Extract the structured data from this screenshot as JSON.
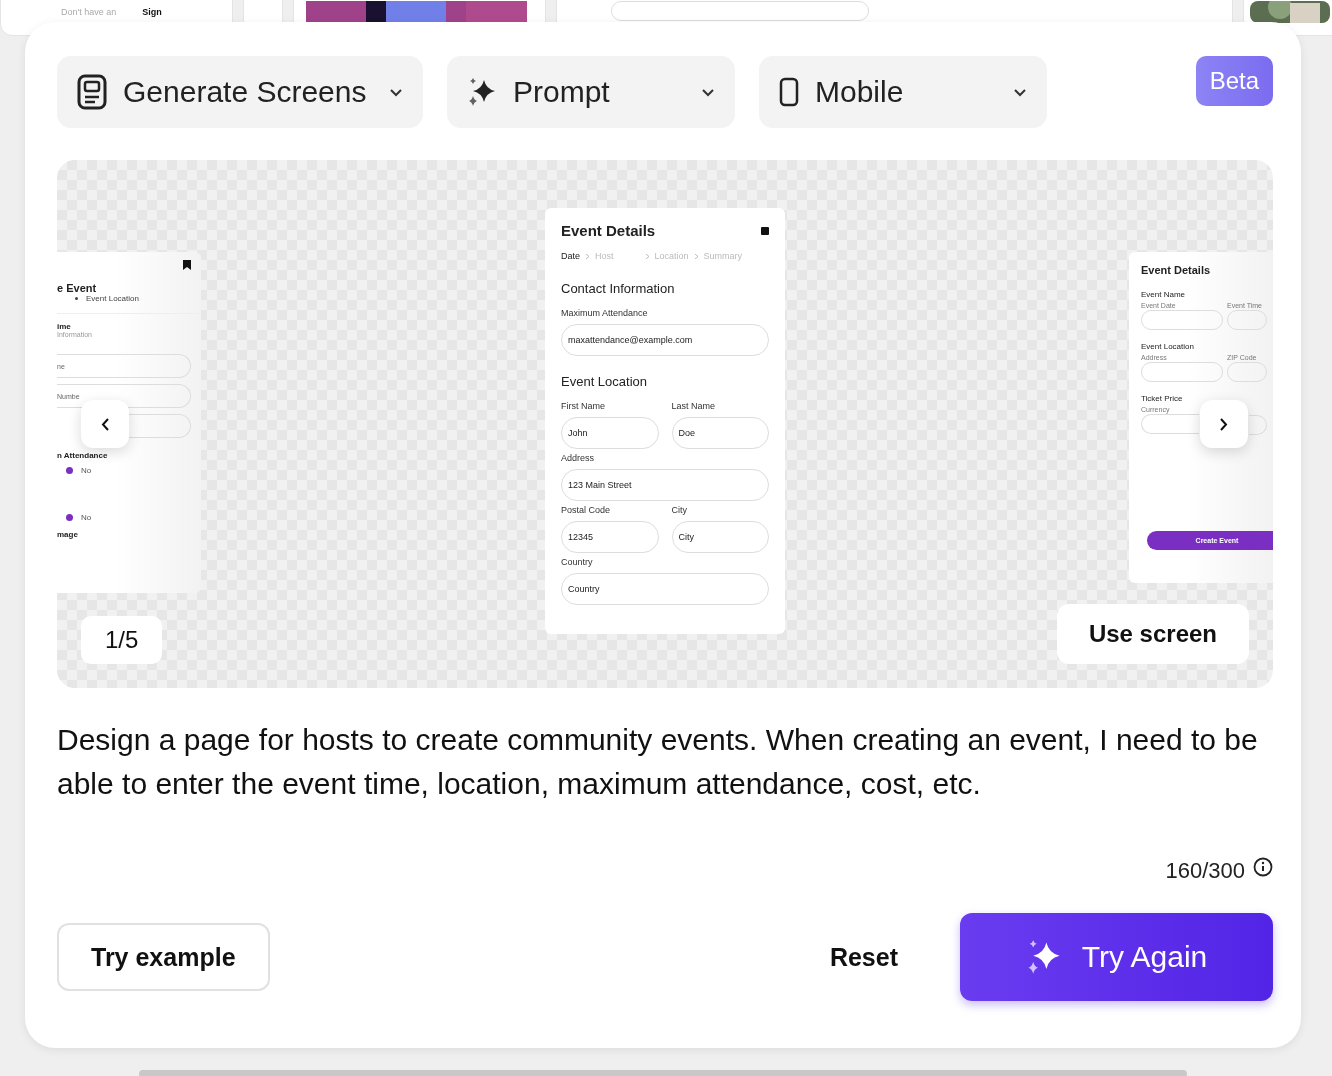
{
  "background_cards": {
    "signup_hint": "Don't have an",
    "signup_link": "Sign"
  },
  "toolbar": {
    "dropdowns": [
      {
        "kind": "document",
        "label": "Generate Screens"
      },
      {
        "kind": "sparkle",
        "label": "Prompt"
      },
      {
        "kind": "phone",
        "label": "Mobile"
      }
    ],
    "badge": "Beta"
  },
  "preview": {
    "left_screen": {
      "title": "e Event",
      "step": "Event Location",
      "section_title": "ime",
      "section_subtitle": "Information",
      "fields": [
        {
          "kind": "text",
          "value": "ne"
        },
        {
          "kind": "text",
          "value": "Numbe"
        },
        {
          "kind": "blank"
        }
      ],
      "group_title": "n Attendance",
      "radios": [
        {
          "label": "No"
        },
        {
          "label": "No"
        }
      ],
      "image_label": "mage"
    },
    "center_screen": {
      "title": "Event Details",
      "steps": [
        {
          "label": "Date",
          "selected": true
        },
        {
          "label": "Host",
          "selected": false
        },
        {
          "label": "Location",
          "selected": false
        },
        {
          "label": "Summary",
          "selected": false
        }
      ],
      "sections": [
        {
          "title": "Contact Information",
          "rows": [
            [
              {
                "label": "Maximum Attendance",
                "value": "maxattendance@example.com"
              }
            ]
          ]
        },
        {
          "title": "Event Location",
          "rows": [
            [
              {
                "label": "First Name",
                "value": "John"
              },
              {
                "label": "Last Name",
                "value": "Doe"
              }
            ],
            [
              {
                "label": "Address",
                "value": "123 Main Street"
              }
            ],
            [
              {
                "label": "Postal Code",
                "value": "12345"
              },
              {
                "label": "City",
                "value": "City"
              }
            ],
            [
              {
                "label": "Country",
                "value": "Country"
              }
            ]
          ]
        }
      ]
    },
    "right_screen": {
      "title": "Event Details",
      "sections": [
        {
          "title": "Event Name",
          "fields": [
            {
              "kind": "labeled",
              "label": "Event Date"
            },
            {
              "kind": "labeled",
              "label": "Event Time"
            }
          ]
        },
        {
          "title": "Event Location",
          "fields": [
            {
              "kind": "labeled",
              "label": "Address"
            },
            {
              "kind": "labeled",
              "label": "ZIP Code"
            }
          ]
        },
        {
          "title": "Ticket Price",
          "fields": [
            {
              "kind": "labeled",
              "label": "Currency"
            },
            {
              "kind": "blank"
            }
          ]
        }
      ],
      "button": "Create Event"
    },
    "counter": "1/5",
    "use_button": "Use screen"
  },
  "prompt": {
    "text": "Design a page for hosts to create community events. When creating an event, I need to be able to enter the event time, location, maximum attendance, cost, etc.",
    "count": "160/300"
  },
  "actions": {
    "example": "Try example",
    "reset": "Reset",
    "submit": "Try Again"
  }
}
